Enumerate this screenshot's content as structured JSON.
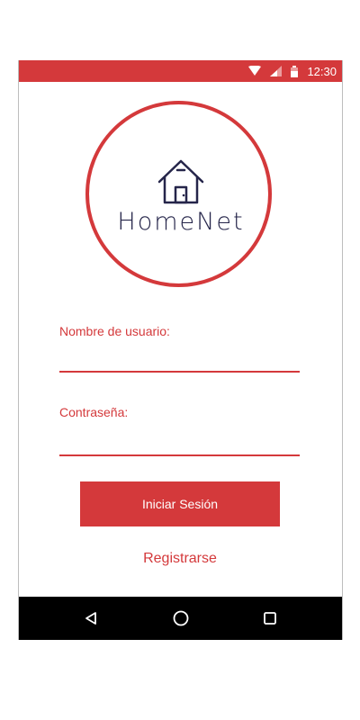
{
  "status_bar": {
    "time": "12:30",
    "color": "#d4393b"
  },
  "logo": {
    "text": "HomeNet",
    "icon": "house-icon"
  },
  "form": {
    "username_label": "Nombre de usuario:",
    "username_value": "",
    "password_label": "Contraseña:",
    "password_value": "",
    "login_label": "Iniciar Sesión",
    "register_label": "Registrarse"
  },
  "nav": {
    "back_icon": "back-triangle-icon",
    "home_icon": "home-circle-icon",
    "recents_icon": "recents-square-icon"
  },
  "colors": {
    "accent": "#d4393b",
    "logo_text": "#25254a",
    "nav_bg": "#000000"
  }
}
